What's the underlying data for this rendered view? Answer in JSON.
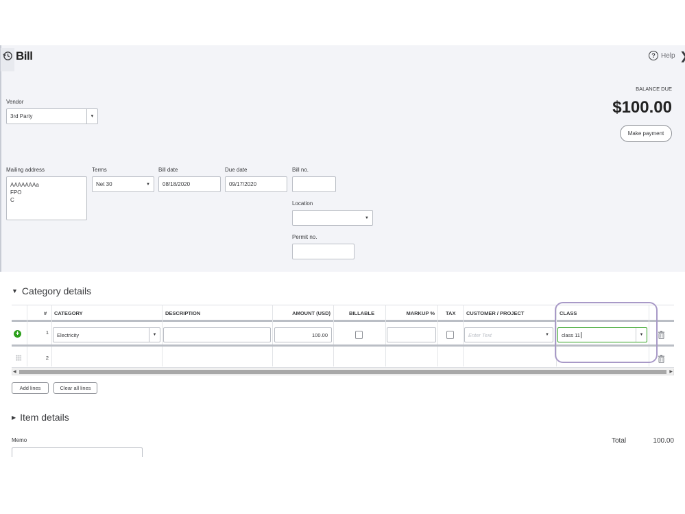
{
  "window": {
    "title": "Bill",
    "help_label": "Help"
  },
  "balance": {
    "label": "BALANCE DUE",
    "amount": "$100.00",
    "make_payment_label": "Make payment"
  },
  "vendor": {
    "label": "Vendor",
    "value": "3rd Party"
  },
  "mailing_address": {
    "label": "Mailing address",
    "lines": [
      "AAAAAAAa",
      "FPO",
      "C"
    ]
  },
  "terms": {
    "label": "Terms",
    "value": "Net 30"
  },
  "bill_date": {
    "label": "Bill date",
    "value": "08/18/2020"
  },
  "due_date": {
    "label": "Due date",
    "value": "09/17/2020"
  },
  "bill_no": {
    "label": "Bill no.",
    "value": ""
  },
  "location": {
    "label": "Location",
    "value": ""
  },
  "permit_no": {
    "label": "Permit no.",
    "value": ""
  },
  "category_section": {
    "title": "Category details",
    "columns": {
      "num": "#",
      "category": "CATEGORY",
      "description": "DESCRIPTION",
      "amount": "AMOUNT (USD)",
      "billable": "BILLABLE",
      "markup": "MARKUP %",
      "tax": "TAX",
      "customer": "CUSTOMER / PROJECT",
      "class": "CLASS"
    },
    "rows": [
      {
        "num": "1",
        "category": "Electricity",
        "description": "",
        "amount": "100.00",
        "markup": "",
        "customer_placeholder": "Enter Text",
        "class": "class 11"
      },
      {
        "num": "2"
      }
    ],
    "add_lines_label": "Add lines",
    "clear_lines_label": "Clear all lines"
  },
  "item_section": {
    "title": "Item details"
  },
  "memo": {
    "label": "Memo"
  },
  "total": {
    "label": "Total",
    "value": "100.00"
  },
  "colors": {
    "header_bg": "#f3f4f8",
    "accent_green": "#2ca01c",
    "highlight_purple": "#a899c7"
  }
}
